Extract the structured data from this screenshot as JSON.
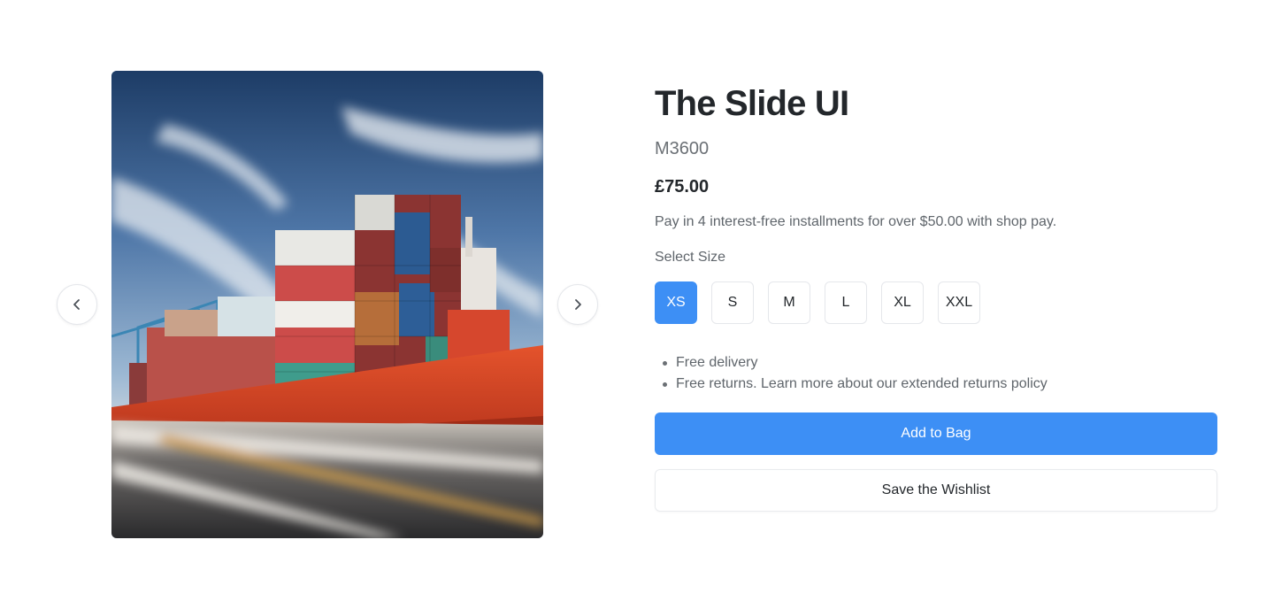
{
  "product": {
    "title": "The Slide UI",
    "sku": "M3600",
    "price": "£75.00",
    "installments": "Pay in 4 interest-free installments for over $50.00 with shop pay.",
    "size_label": "Select Size",
    "sizes": [
      "XS",
      "S",
      "M",
      "L",
      "XL",
      "XXL"
    ],
    "selected_size": "XS",
    "features": [
      "Free delivery",
      "Free returns. Learn more about our extended returns policy"
    ],
    "add_to_bag_label": "Add to Bag",
    "wishlist_label": "Save the Wishlist"
  },
  "carousel": {
    "image_subject": "cargo ship with stacked containers on a motion-blurred road",
    "prev_icon": "chevron-left-icon",
    "next_icon": "chevron-right-icon"
  },
  "colors": {
    "accent": "#3d8ff5",
    "text_primary": "#23272b",
    "text_secondary": "#5f656b",
    "border": "#e5e7eb"
  }
}
